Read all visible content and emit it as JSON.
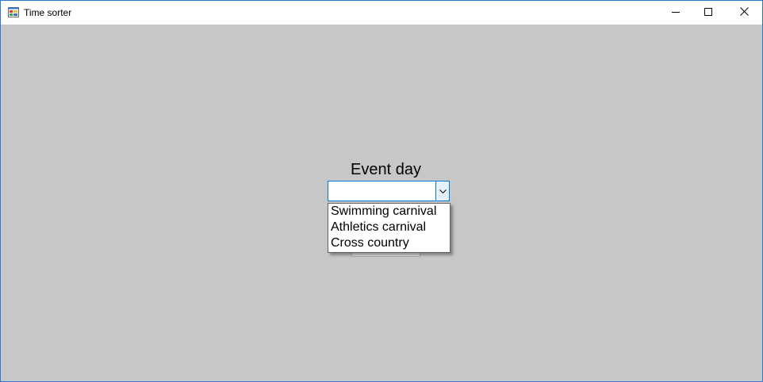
{
  "window": {
    "title": "Time sorter",
    "accent_color": "#2b79d0",
    "background_color": "#c7c7c7"
  },
  "form": {
    "event_label": "Event day",
    "event_combo": {
      "selected_value": "",
      "options": [
        "Swimming carnival",
        "Athletics carnival",
        "Cross country"
      ]
    }
  },
  "icons": {
    "app": "app-icon",
    "minimize": "minimize-icon",
    "maximize": "maximize-icon",
    "close": "close-icon",
    "dropdown": "chevron-down-icon"
  }
}
